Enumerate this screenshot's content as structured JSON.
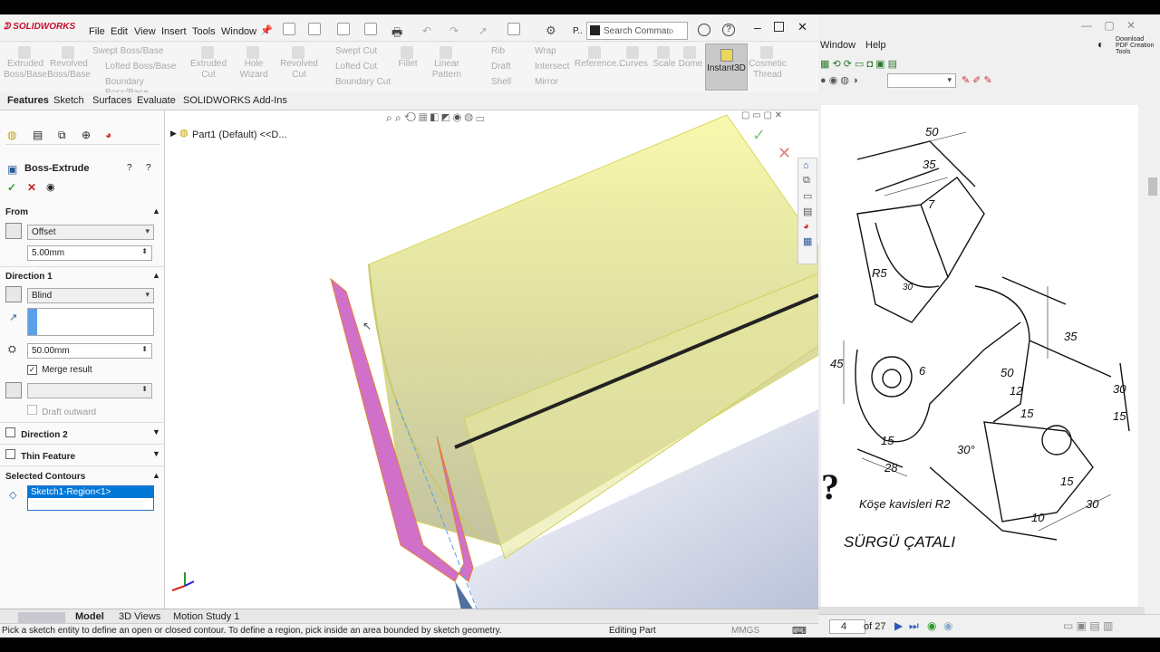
{
  "app": {
    "logo": "SOLIDWORKS",
    "menus": [
      "File",
      "Edit",
      "View",
      "Insert",
      "Tools",
      "Window"
    ],
    "search_placeholder": "Search Commar",
    "extra_label": "P.."
  },
  "ribbon": {
    "large": [
      {
        "label": "Extruded Boss/Base"
      },
      {
        "label": "Revolved Boss/Base"
      },
      {
        "label": "Extruded Cut"
      },
      {
        "label": "Hole Wizard"
      },
      {
        "label": "Revolved Cut"
      },
      {
        "label": "Fillet"
      },
      {
        "label": "Linear Pattern"
      },
      {
        "label": "Reference..."
      },
      {
        "label": "Curves"
      },
      {
        "label": "Scale"
      },
      {
        "label": "Dome"
      },
      {
        "label": "Instant3D"
      },
      {
        "label": "Cosmetic Thread"
      }
    ],
    "small_col1": [
      "Swept Boss/Base",
      "Lofted Boss/Base",
      "Boundary Boss/Base"
    ],
    "small_col2": [
      "Swept Cut",
      "Lofted Cut",
      "Boundary Cut"
    ],
    "small_col3": [
      "Rib",
      "Draft",
      "Shell"
    ],
    "small_col4": [
      "Wrap",
      "Intersect",
      "Mirror"
    ]
  },
  "tabs": [
    "Features",
    "Sketch",
    "Surfaces",
    "Evaluate",
    "SOLIDWORKS Add-Ins"
  ],
  "tree": {
    "part": "Part1 (Default) <<D..."
  },
  "pm": {
    "title": "Boss-Extrude",
    "from_label": "From",
    "from_value": "Offset",
    "offset_value": "5.00mm",
    "dir1_label": "Direction 1",
    "dir1_type": "Blind",
    "depth_value": "50.00mm",
    "merge_label": "Merge result",
    "draft_label": "Draft outward",
    "dir2_label": "Direction 2",
    "thin_label": "Thin Feature",
    "contours_label": "Selected Contours",
    "contour_item": "Sketch1-Region<1>"
  },
  "bottom_tabs": [
    "Model",
    "3D Views",
    "Motion Study 1"
  ],
  "status": {
    "hint": "Pick a sketch entity to define an open or closed contour. To define a region, pick inside an area bounded by sketch geometry.",
    "mode": "Editing Part",
    "units": "MMGS"
  },
  "pdf": {
    "menus": [
      "Window",
      "Help"
    ],
    "download_label": "Download PDF Creation Tools",
    "page_current": "4",
    "page_total": "of 27",
    "drawing": {
      "dims": [
        "50",
        "35",
        "7",
        "R5",
        "30",
        "45",
        "35",
        "50",
        "12",
        "6",
        "30",
        "15",
        "15",
        "28",
        "30°",
        "15",
        "10",
        "30",
        "15"
      ],
      "note": "Köşe kavisleri R2",
      "title": "SÜRGÜ  ÇATALI",
      "mark": "?"
    }
  },
  "colors": {
    "accent_blue": "#0a64c8",
    "selection": "#0078d7",
    "body_yellow": "#f5f56a",
    "profile_pink": "#d070c8"
  }
}
